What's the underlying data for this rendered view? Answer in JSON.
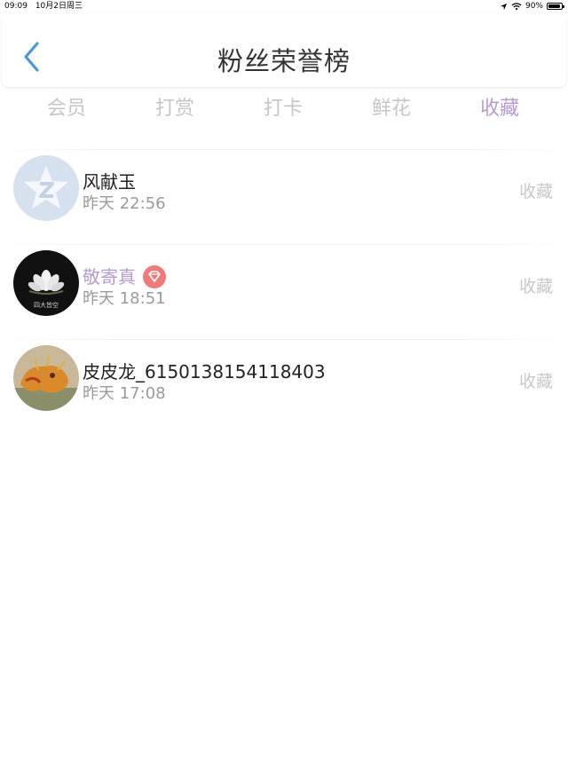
{
  "status_bar": {
    "time": "09:09",
    "date": "10月2日周三",
    "battery": "90%",
    "battery_level": 0.9
  },
  "header": {
    "title": "粉丝荣誉榜",
    "back_icon": "chevron-left-icon"
  },
  "tabs": [
    {
      "label": "会员",
      "active": false
    },
    {
      "label": "打赏",
      "active": false
    },
    {
      "label": "打卡",
      "active": false
    },
    {
      "label": "鲜花",
      "active": false
    },
    {
      "label": "收藏",
      "active": true
    }
  ],
  "rows": [
    {
      "name": "风献玉",
      "time": "昨天 22:56",
      "action": "收藏"
    },
    {
      "name": "敬寄真",
      "time": "昨天 18:51",
      "action": "收藏",
      "badge_icon": "diamond-icon",
      "avatar_caption": "四大皆空"
    },
    {
      "name": "皮皮龙_6150138154118403",
      "time": "昨天 17:08",
      "action": "收藏"
    }
  ],
  "colors": {
    "accent": "#b69ad6",
    "back_arrow": "#4a97dd",
    "badge": "#f07a7a",
    "inactive_tab": "#c6c6c6"
  }
}
